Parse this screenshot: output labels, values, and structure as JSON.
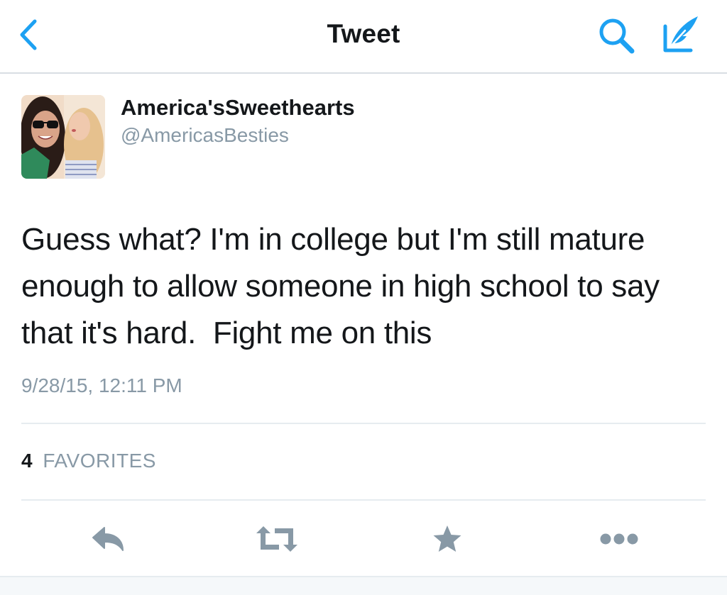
{
  "colors": {
    "accent": "#1da1f2",
    "text": "#14171a",
    "muted": "#8899a6",
    "action_icon": "#8899a6"
  },
  "header": {
    "title": "Tweet",
    "back_icon": "chevron-left-icon",
    "search_icon": "search-icon",
    "compose_icon": "compose-tweet-icon"
  },
  "tweet": {
    "author_name": "America'sSweethearts",
    "author_handle": "@AmericasBesties",
    "text": "Guess what? I'm in college but I'm still mature enough to allow someone in high school to say that it's hard.  Fight me on this",
    "timestamp": "9/28/15, 12:11 PM",
    "favorites_count": "4",
    "favorites_label": "FAVORITES"
  },
  "actions": [
    {
      "icon": "reply-icon"
    },
    {
      "icon": "retweet-icon"
    },
    {
      "icon": "favorite-star-icon"
    },
    {
      "icon": "more-dots-icon"
    }
  ]
}
